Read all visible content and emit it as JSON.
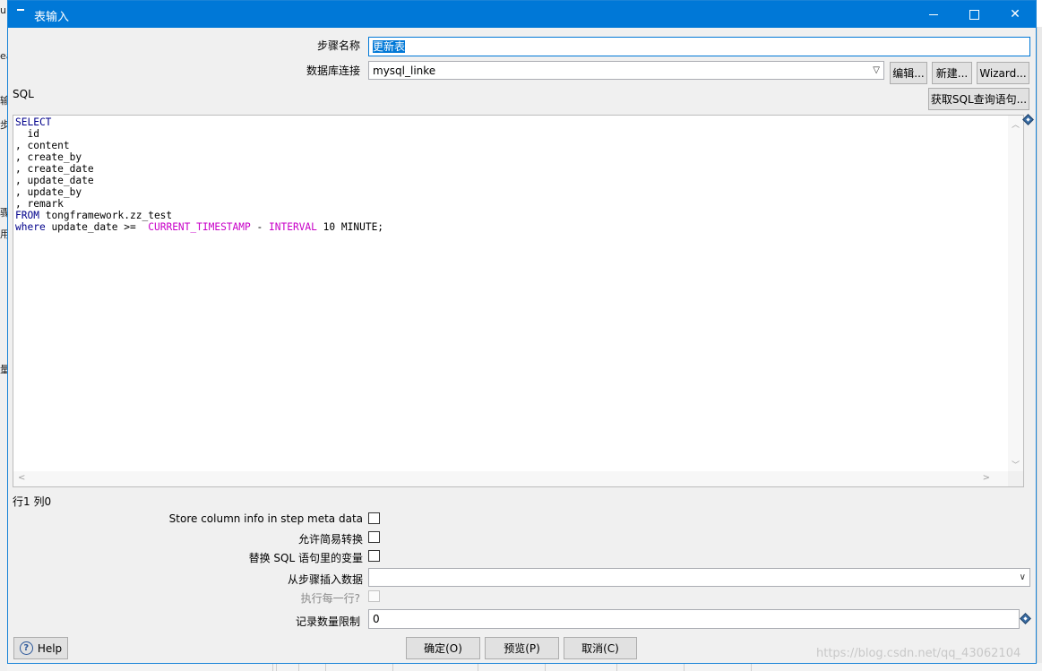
{
  "window": {
    "title": "表输入"
  },
  "form": {
    "step_name_label": "步骤名称",
    "step_name_value": "更新表",
    "db_conn_label": "数据库连接",
    "db_conn_value": "mysql_linke",
    "edit_button": "编辑...",
    "new_button": "新建...",
    "wizard_button": "Wizard...",
    "sql_label": "SQL",
    "get_sql_button": "获取SQL查询语句..."
  },
  "sql": {
    "lines": [
      "SELECT",
      "  id",
      ", content",
      ", create_by",
      ", create_date",
      ", update_date",
      ", update_by",
      ", remark",
      "FROM tongframework.zz_test",
      "where update_date >=  CURRENT_TIMESTAMP - INTERVAL 10 MINUTE;"
    ]
  },
  "status": {
    "cursor_position": "行1 列0"
  },
  "options": {
    "store_column_info_label": "Store column info in step meta data",
    "store_column_info_checked": false,
    "lazy_conversion_label": "允许简易转换",
    "lazy_conversion_checked": false,
    "replace_vars_label": "替换 SQL 语句里的变量",
    "replace_vars_checked": false,
    "insert_from_step_label": "从步骤插入数据",
    "insert_from_step_value": "",
    "execute_each_row_label": "执行每一行?",
    "execute_each_row_checked": false,
    "limit_label": "记录数量限制",
    "limit_value": "0"
  },
  "buttons": {
    "help": "Help",
    "ok": "确定(O)",
    "preview": "预览(P)",
    "cancel": "取消(C)"
  },
  "background": {
    "left_edge_chars": [
      "u",
      "ea",
      "输",
      "步",
      "骤",
      "用",
      "结",
      "量"
    ]
  },
  "watermark": "https://blog.csdn.net/qq_43062104",
  "colors": {
    "titlebar": "#0078d7",
    "keyword": "#00008b",
    "function": "#c800c8"
  }
}
